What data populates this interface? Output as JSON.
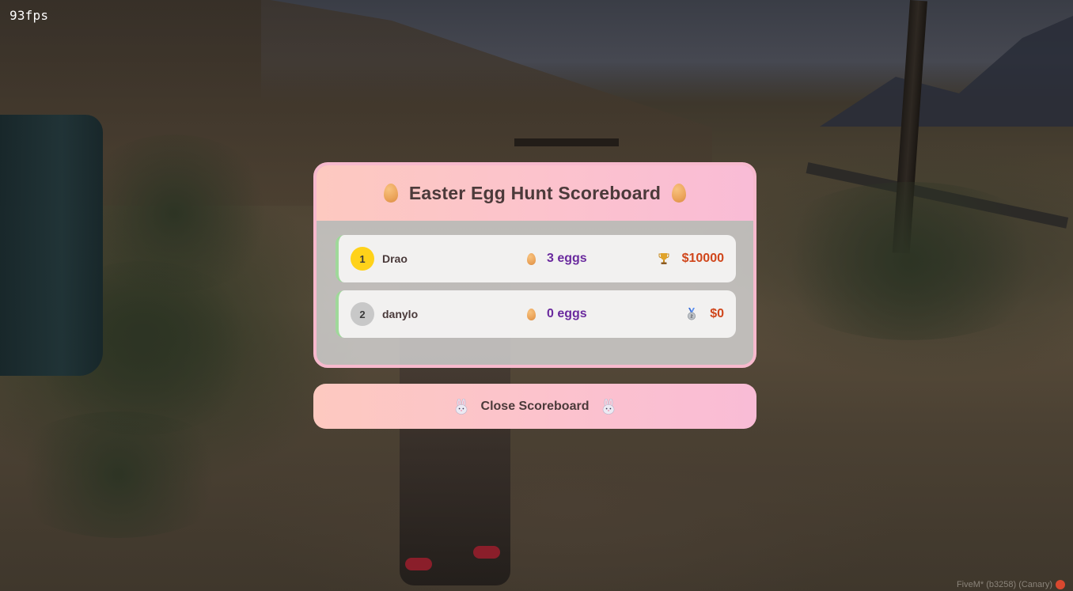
{
  "overlay": {
    "fps": "93fps",
    "watermark": "FiveM* (b3258) (Canary)"
  },
  "scoreboard": {
    "title": "Easter Egg Hunt Scoreboard",
    "title_icon": "egg-icon",
    "players": [
      {
        "rank": "1",
        "name": "Drao",
        "eggs": "3 eggs",
        "prize": "$10000",
        "prize_icon": "trophy-icon",
        "rank_color": "#ffd21a"
      },
      {
        "rank": "2",
        "name": "danylo",
        "eggs": "0 eggs",
        "prize": "$0",
        "prize_icon": "silver-medal-icon",
        "rank_color": "#c8c8c8"
      }
    ]
  },
  "close_button": {
    "label": "Close Scoreboard",
    "icon": "bunny-icon"
  },
  "colors": {
    "header_gradient_start": "#fdc9c0",
    "header_gradient_end": "#f9bcd6",
    "egg_count": "#6a2a9e",
    "prize": "#d0461b",
    "row_accent": "#9fd89a"
  }
}
